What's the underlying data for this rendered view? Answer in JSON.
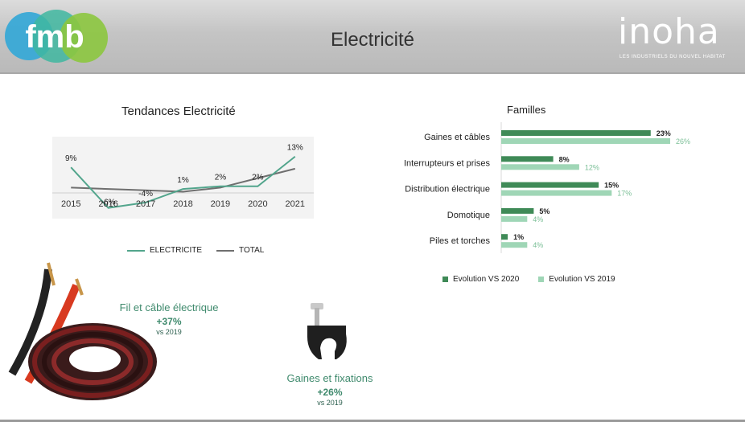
{
  "header": {
    "title": "Electricité",
    "logo_left_text": "fmb",
    "logo_right_text": "inoha",
    "logo_right_tagline": "LES INDUSTRIELS DU NOUVEL HABITAT"
  },
  "colors": {
    "electricite": "#52a58c",
    "total": "#6f6f6f",
    "vs2020": "#3f8a57",
    "vs2019": "#9fd6b6",
    "product_text": "#3f8a6d"
  },
  "chart_data": [
    {
      "type": "line",
      "title": "Tendances Electricité",
      "x": [
        "2015",
        "2016",
        "2017",
        "2018",
        "2019",
        "2020",
        "2021"
      ],
      "series": [
        {
          "name": "ELECTRICITE",
          "values": [
            9,
            -6,
            -4,
            1,
            2,
            2,
            13
          ]
        },
        {
          "name": "TOTAL",
          "values": [
            1.5,
            1,
            0.5,
            0,
            1.5,
            5,
            8.5
          ]
        }
      ],
      "data_labels": [
        "9%",
        "-6%",
        "-4%",
        "1%",
        "2%",
        "2%",
        "13%"
      ],
      "ylim": [
        -7,
        15
      ],
      "legend": "bottom",
      "grid": false
    },
    {
      "type": "bar",
      "orientation": "horizontal",
      "title": "Familles",
      "categories": [
        "Gaines et câbles",
        "Interrupteurs et prises",
        "Distribution électrique",
        "Domotique",
        "Piles et torches"
      ],
      "series": [
        {
          "name": "Evolution VS 2020",
          "values": [
            23,
            8,
            15,
            5,
            1
          ],
          "labels": [
            "23%",
            "8%",
            "15%",
            "5%",
            "1%"
          ]
        },
        {
          "name": "Evolution VS 2019",
          "values": [
            26,
            12,
            17,
            4,
            4
          ],
          "labels": [
            "26%",
            "12%",
            "17%",
            "4%",
            "4%"
          ]
        }
      ],
      "xlim": [
        0,
        26
      ],
      "legend": "bottom",
      "grid": false
    }
  ],
  "products": [
    {
      "name": "Fil et câble électrique",
      "pct": "+37%",
      "cmp": "vs 2019"
    },
    {
      "name": "Gaines et fixations",
      "pct": "+26%",
      "cmp": "vs 2019"
    }
  ]
}
